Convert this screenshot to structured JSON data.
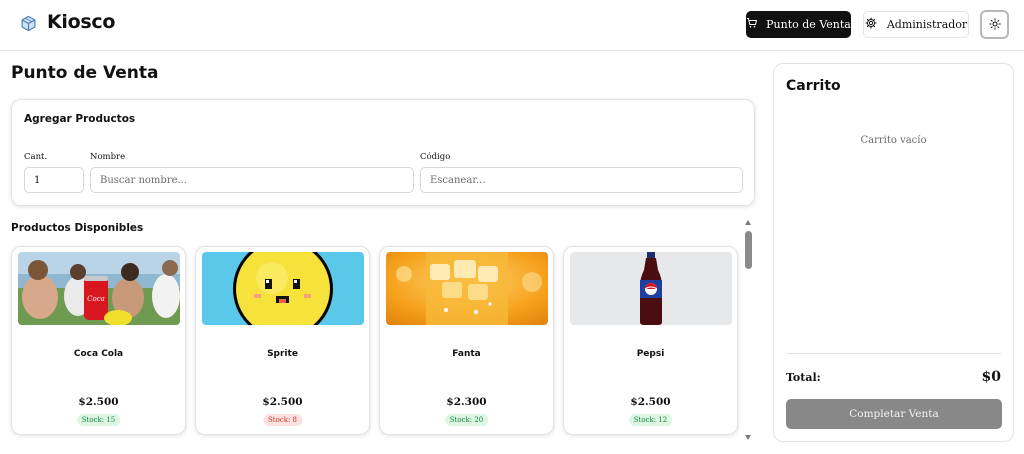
{
  "header": {
    "brand": "Kiosco",
    "logo_icon": "cube-icon",
    "nav": {
      "pos_label": "Punto de Venta",
      "pos_icon": "cart-icon",
      "admin_label": "Administrador",
      "admin_icon": "gear-icon",
      "theme_icon": "sun-icon"
    }
  },
  "main": {
    "title": "Punto de Venta",
    "add_products": {
      "title": "Agregar Productos",
      "quantity": {
        "label": "Cant.",
        "value": "1"
      },
      "name": {
        "label": "Nombre",
        "placeholder": "Buscar nombre..."
      },
      "code": {
        "label": "Código",
        "placeholder": "Escanear..."
      }
    },
    "products_title": "Productos Disponibles",
    "products": [
      {
        "name": "Coca Cola",
        "price": "$2.500",
        "stock": "Stock: 15",
        "stock_status": "ok"
      },
      {
        "name": "Sprite",
        "price": "$2.500",
        "stock": "Stock: 8",
        "stock_status": "low"
      },
      {
        "name": "Fanta",
        "price": "$2.300",
        "stock": "Stock: 20",
        "stock_status": "ok"
      },
      {
        "name": "Pepsi",
        "price": "$2.500",
        "stock": "Stock: 12",
        "stock_status": "ok"
      }
    ]
  },
  "cart": {
    "title": "Carrito",
    "empty_text": "Carrito vacío",
    "total_label": "Total:",
    "total_value": "$0",
    "complete_label": "Completar Venta"
  },
  "colors": {
    "primary": "#111111",
    "stock_ok_bg": "#dcf6e3",
    "stock_ok_text": "#16803c",
    "stock_low_bg": "#fde0e0",
    "stock_low_text": "#c0392b",
    "disabled_button": "#888888"
  }
}
